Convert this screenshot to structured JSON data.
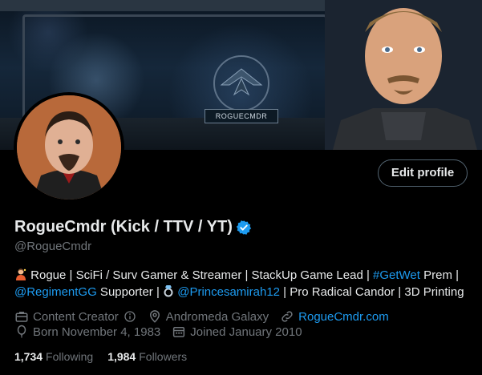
{
  "banner": {
    "hud_caption": "ROGUECMDR"
  },
  "profile": {
    "edit_button_label": "Edit profile",
    "display_name": "RogueCmdr (Kick / TTV / YT)",
    "handle": "@RogueCmdr",
    "bio": {
      "line1_text1": " Rogue | SciFi / Surv Gamer & Streamer | StackUp Game Lead | ",
      "line1_hashtag": "#GetWet",
      "line1_text2": " Prem |",
      "line2_mention1": "@RegimentGG",
      "line2_text1": " Supporter | ",
      "line2_mention2": "@Princesamirah12",
      "line2_text2": " | Pro Radical Candor | 3D Printing"
    },
    "meta": {
      "category": "Content Creator",
      "location": "Andromeda Galaxy",
      "website": "RogueCmdr.com",
      "born": "Born November 4, 1983",
      "joined": "Joined January 2010"
    },
    "stats": {
      "following_count": "1,734",
      "following_label": "Following",
      "followers_count": "1,984",
      "followers_label": "Followers"
    }
  },
  "colors": {
    "accent": "#1d9bf0",
    "muted_text": "#71767b",
    "background": "#000000"
  },
  "icons": [
    "verified-badge-icon",
    "briefcase-icon",
    "info-icon",
    "location-pin-icon",
    "link-icon",
    "balloon-icon",
    "calendar-icon",
    "ring-emoji-icon",
    "person-emoji-icon"
  ]
}
